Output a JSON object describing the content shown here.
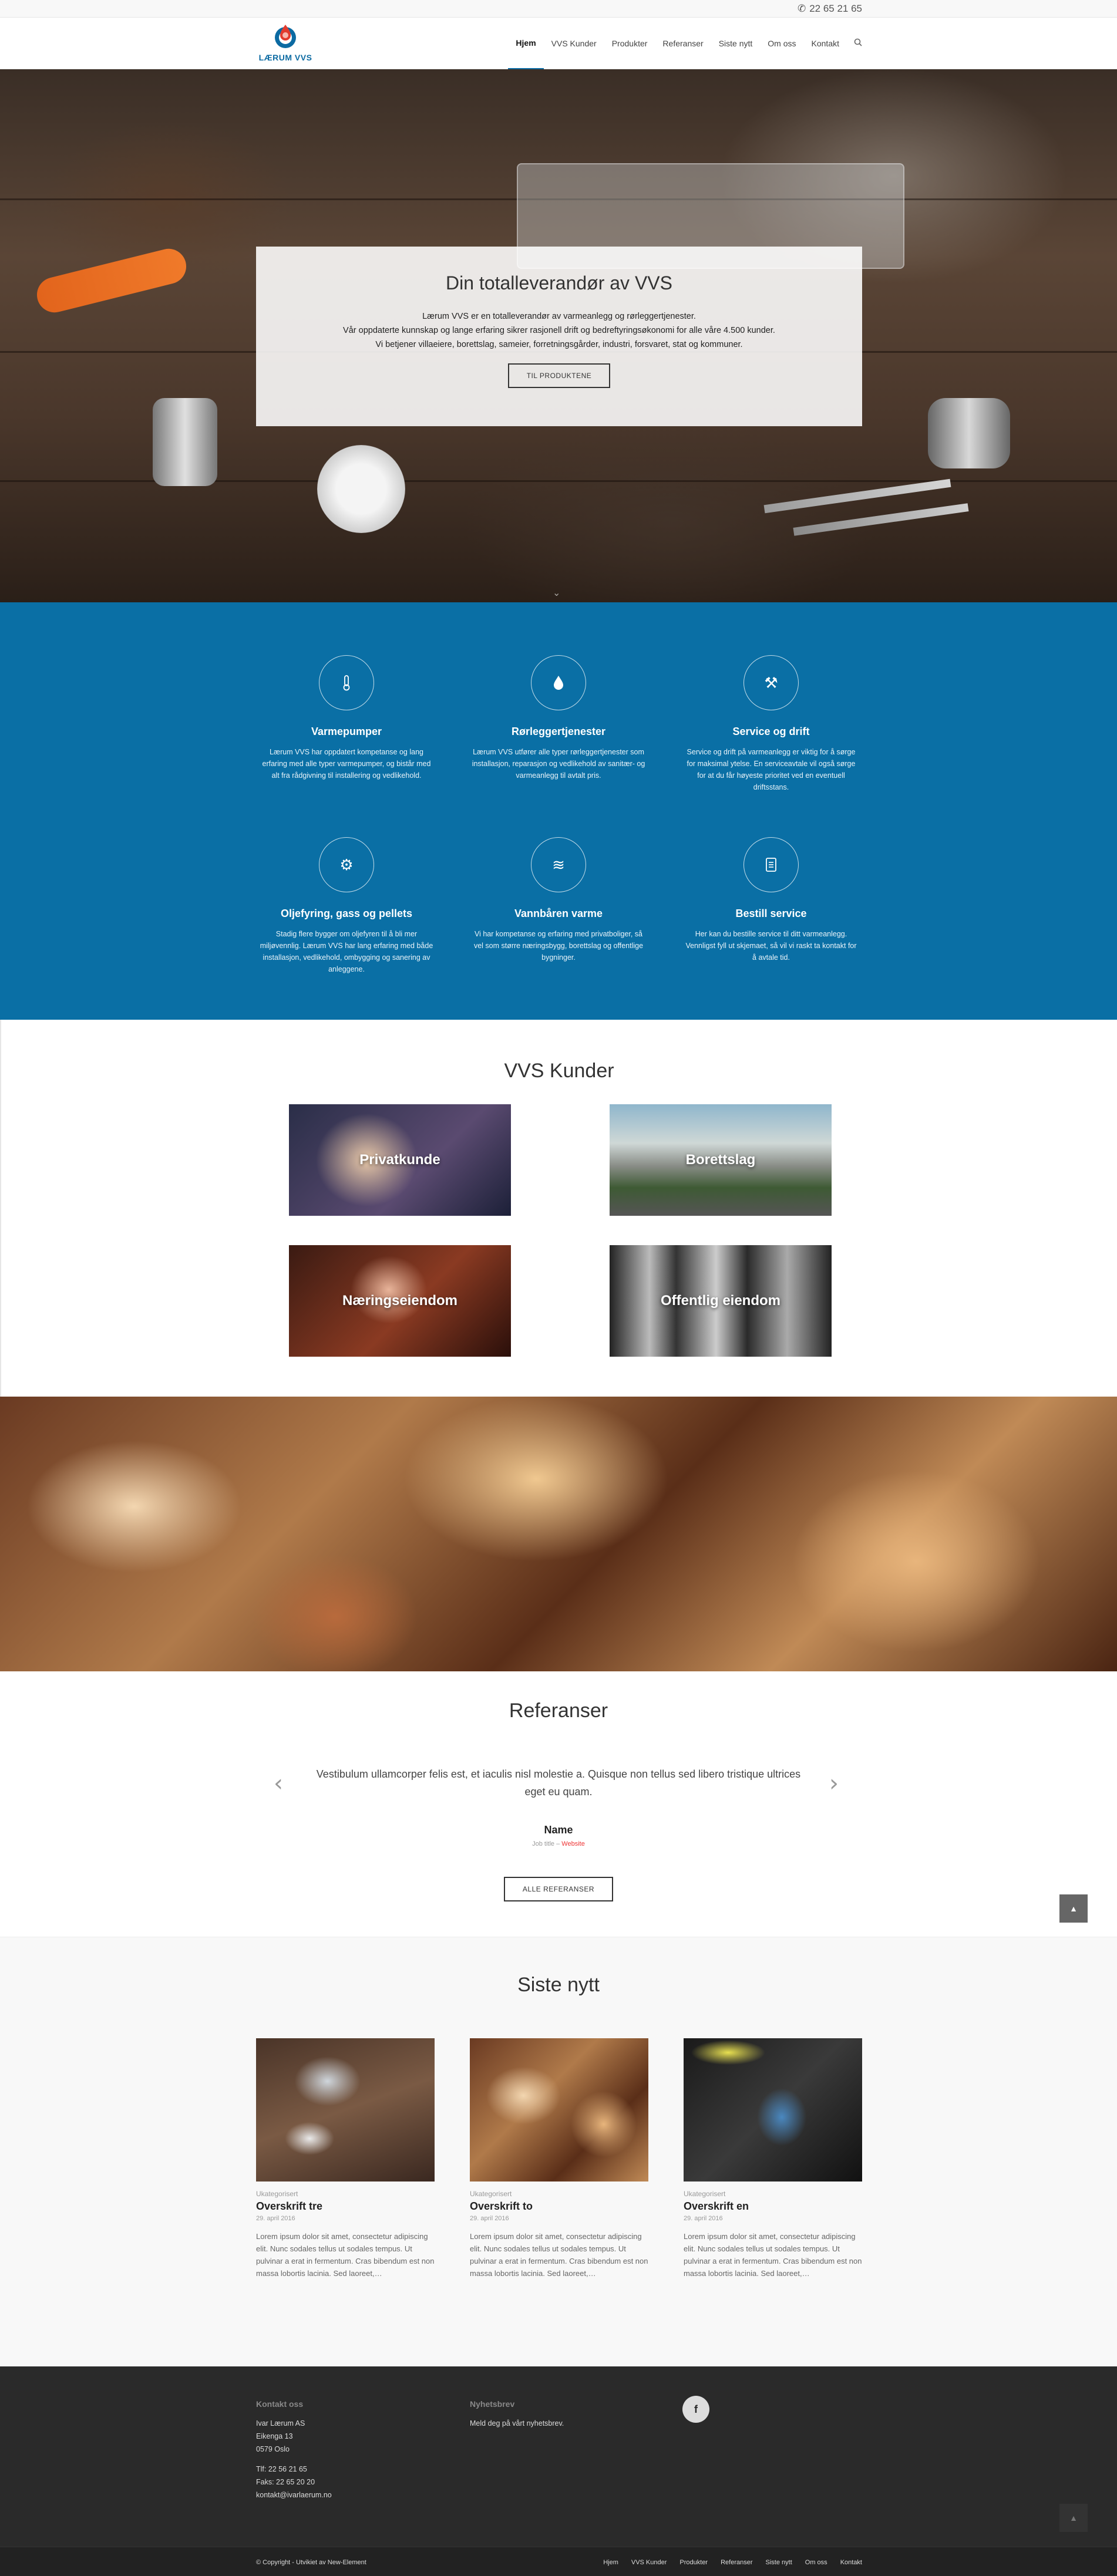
{
  "topbar": {
    "phone": "22 65 21 65",
    "phone_icon": "phone-icon"
  },
  "header": {
    "logo_text": "LÆRUM VVS",
    "nav": [
      "Hjem",
      "VVS Kunder",
      "Produkter",
      "Referanser",
      "Siste nytt",
      "Om oss",
      "Kontakt"
    ],
    "active": "Hjem",
    "search_icon": "search-icon"
  },
  "hero": {
    "title": "Din totalleverandør av VVS",
    "line1": "Lærum VVS er en totalleverandør av varmeanlegg og rørleggertjenester.",
    "line2": "Vår oppdaterte kunnskap og lange erfaring sikrer rasjonell drift og bedreftyringsøkonomi for alle våre 4.500 kunder.",
    "line3": "Vi betjener villaeiere, borettslag, sameier, forretningsgårder, industri, forsvaret, stat og kommuner.",
    "button": "TIL PRODUKTENE"
  },
  "services": [
    {
      "icon": "thermometer-icon",
      "title": "Varmepumper",
      "text": "Lærum VVS har oppdatert kompetanse og lang erfaring med alle typer varmepumper, og bistår med alt fra rådgivning til installering og vedlikehold."
    },
    {
      "icon": "water-drop-icon",
      "title": "Rørleggertjenester",
      "text": "Lærum VVS utfører alle typer rørleggertjenester som installasjon, reparasjon og vedlikehold av sanitær- og varmeanlegg til avtalt pris."
    },
    {
      "icon": "tools-icon",
      "title": "Service og drift",
      "text": "Service og drift på varmeanlegg er viktig for å sørge for maksimal ytelse. En serviceavtale vil også sørge for at du får høyeste prioritet ved en eventuell driftsstans."
    },
    {
      "icon": "gear-icon",
      "title": "Oljefyring, gass og pellets",
      "text": "Stadig flere bygger om oljefyren til å bli mer miljøvennlig. Lærum VVS har lang erfaring med både installasjon, vedlikehold, ombygging og sanering av anleggene."
    },
    {
      "icon": "waves-icon",
      "title": "Vannbåren varme",
      "text": "Vi har kompetanse og erfaring med privatboliger, så vel som større næringsbygg, borettslag og offentlige bygninger."
    },
    {
      "icon": "document-icon",
      "title": "Bestill service",
      "text": "Her kan du bestille service til ditt varmeanlegg. Vennligst fyll ut skjemaet, så vil vi raskt ta kontakt for å avtale tid."
    }
  ],
  "kunder": {
    "title": "VVS Kunder",
    "tiles": [
      "Privatkunde",
      "Borettslag",
      "Næringseiendom",
      "Offentlig eiendom"
    ]
  },
  "referanser": {
    "title": "Referanser",
    "quote": "Vestibulum ullamcorper felis est, et iaculis nisl molestie a. Quisque non tellus sed libero tristique ultrices eget eu quam.",
    "name": "Name",
    "job": "Job title",
    "separator": " – ",
    "site": "Website",
    "button": "ALLE REFERANSER",
    "prev_icon": "chevron-left-icon",
    "next_icon": "chevron-right-icon"
  },
  "nytt": {
    "title": "Siste nytt",
    "posts": [
      {
        "category": "Ukategorisert",
        "title": "Overskrift tre",
        "date": "29. april 2016",
        "excerpt": "Lorem ipsum dolor sit amet, consectetur adipiscing elit. Nunc sodales tellus ut sodales tempus. Ut pulvinar a erat in fermentum. Cras bibendum est non massa lobortis lacinia. Sed laoreet,…"
      },
      {
        "category": "Ukategorisert",
        "title": "Overskrift to",
        "date": "29. april 2016",
        "excerpt": "Lorem ipsum dolor sit amet, consectetur adipiscing elit. Nunc sodales tellus ut sodales tempus. Ut pulvinar a erat in fermentum. Cras bibendum est non massa lobortis lacinia. Sed laoreet,…"
      },
      {
        "category": "Ukategorisert",
        "title": "Overskrift en",
        "date": "29. april 2016",
        "excerpt": "Lorem ipsum dolor sit amet, consectetur adipiscing elit. Nunc sodales tellus ut sodales tempus. Ut pulvinar a erat in fermentum. Cras bibendum est non massa lobortis lacinia. Sed laoreet,…"
      }
    ]
  },
  "footer": {
    "kontakt_title": "Kontakt oss",
    "company": "Ivar Lærum AS",
    "street": "Eikenga 13",
    "city": "0579 Oslo",
    "tlf": "Tlf: 22 56 21 65",
    "faks": "Faks: 22 65 20 20",
    "email": "kontakt@ivarlaerum.no",
    "newsletter_title": "Nyhetsbrev",
    "newsletter_text": "Meld deg på vårt nyhetsbrev.",
    "facebook": "f",
    "copyright": "© Copyright - Utvikiet av New-Element",
    "nav": [
      "Hjem",
      "VVS Kunder",
      "Produkter",
      "Referanser",
      "Siste nytt",
      "Om oss",
      "Kontakt"
    ]
  },
  "colors": {
    "accent": "#0a6fa5",
    "footer": "#2a2a2a",
    "link_red": "#e33"
  }
}
